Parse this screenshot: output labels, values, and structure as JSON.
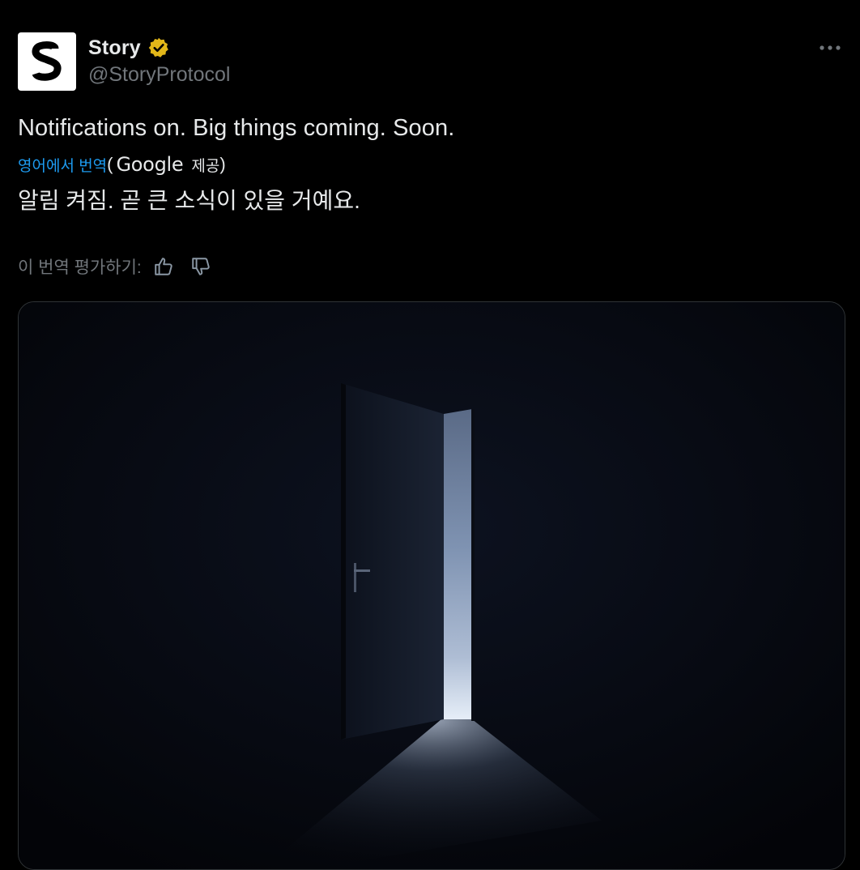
{
  "author": {
    "display_name": "Story",
    "handle": "@StoryProtocol",
    "avatar_icon": "story-s-logo-icon",
    "verified_icon": "gold-verified-badge-icon",
    "verified_color": "#e2b719"
  },
  "more_icon": "more-horizontal-icon",
  "tweet": {
    "text": "Notifications on. Big things coming. Soon.",
    "translate_link": "영어에서 번역",
    "translate_open_paren": "(",
    "translate_provider": "Google",
    "translate_provided": "제공",
    "translate_close_paren": ")",
    "translated_text": "알림 켜짐. 곧 큰 소식이 있을 거예요.",
    "rate_label": "이 번역 평가하기:",
    "thumbs_up_icon": "thumbs-up-icon",
    "thumbs_down_icon": "thumbs-down-icon"
  },
  "media": {
    "image_icon": "open-door-dark-room-image"
  },
  "colors": {
    "background": "#000000",
    "text_primary": "#e7e9ea",
    "text_secondary": "#71767b",
    "link": "#1d9bf0",
    "border": "#2f3336"
  }
}
